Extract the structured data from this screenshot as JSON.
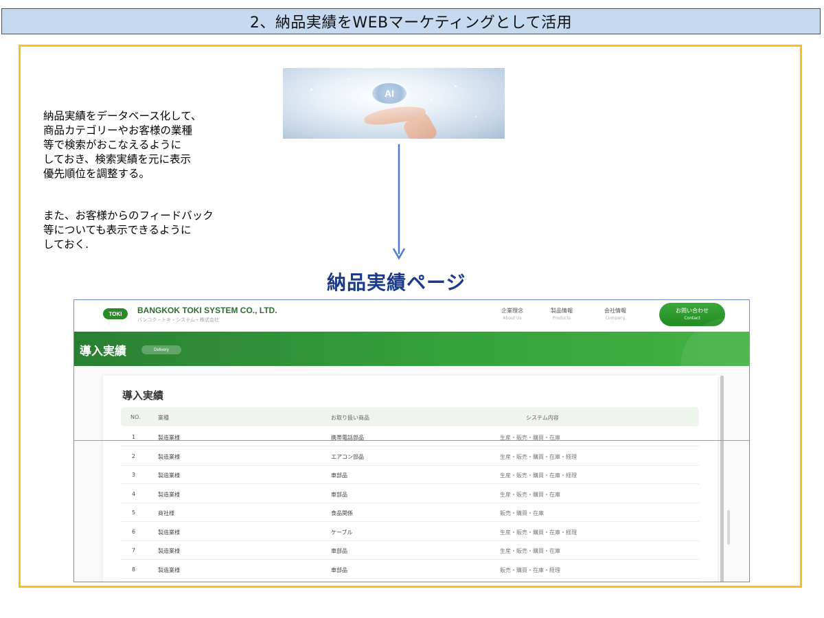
{
  "banner": {
    "title": "2、納品実績をWEBマーケティングとして活用"
  },
  "ai_image": {
    "label": "AI"
  },
  "description": {
    "paragraph1": [
      "納品実績をデータベース化して、",
      "商品カテゴリーやお客様の業種",
      "等で検索がおこなえるように",
      "しておき、検索実績を元に表示",
      "優先順位を調整する。"
    ],
    "paragraph2": [
      "また、お客様からのフィードバック",
      "等についても表示できるように",
      "しておく."
    ]
  },
  "page_heading": "納品実績ページ",
  "site": {
    "logo": "TOKI",
    "company_name": "BANGKOK TOKI SYSTEM CO., LTD.",
    "company_sub": "バンコク・トキ・システム・株式会社",
    "nav": [
      {
        "jp": "企業理念",
        "en": "About Us"
      },
      {
        "jp": "製品情報",
        "en": "Products"
      },
      {
        "jp": "会社情報",
        "en": "Company"
      }
    ],
    "contact": {
      "jp": "お問い合わせ",
      "en": "Contact"
    },
    "hero_title": "導入実績",
    "hero_badge": "Delivery",
    "card_title": "導入実績",
    "table": {
      "headers": {
        "no": "NO.",
        "industry": "業種",
        "product": "お取り扱い商品",
        "system": "システム内容"
      },
      "rows": [
        {
          "no": "1",
          "industry": "製造業様",
          "product": "携帯電話部品",
          "system": "生産・販売・購買・在庫"
        },
        {
          "no": "2",
          "industry": "製造業様",
          "product": "エアコン部品",
          "system": "生産・販売・購買・在庫・経理"
        },
        {
          "no": "3",
          "industry": "製造業様",
          "product": "車部品",
          "system": "生産・販売・購買・在庫・経理"
        },
        {
          "no": "4",
          "industry": "製造業様",
          "product": "車部品",
          "system": "生産・販売・購買・在庫"
        },
        {
          "no": "5",
          "industry": "商社様",
          "product": "食品関係",
          "system": "販売・購買・在庫"
        },
        {
          "no": "6",
          "industry": "製造業様",
          "product": "ケーブル",
          "system": "生産・販売・購買・在庫・経理"
        },
        {
          "no": "7",
          "industry": "製造業様",
          "product": "車部品",
          "system": "生産・販売・購買・在庫"
        },
        {
          "no": "8",
          "industry": "製造業様",
          "product": "車部品",
          "system": "販売・購買・在庫・経理"
        }
      ]
    }
  }
}
